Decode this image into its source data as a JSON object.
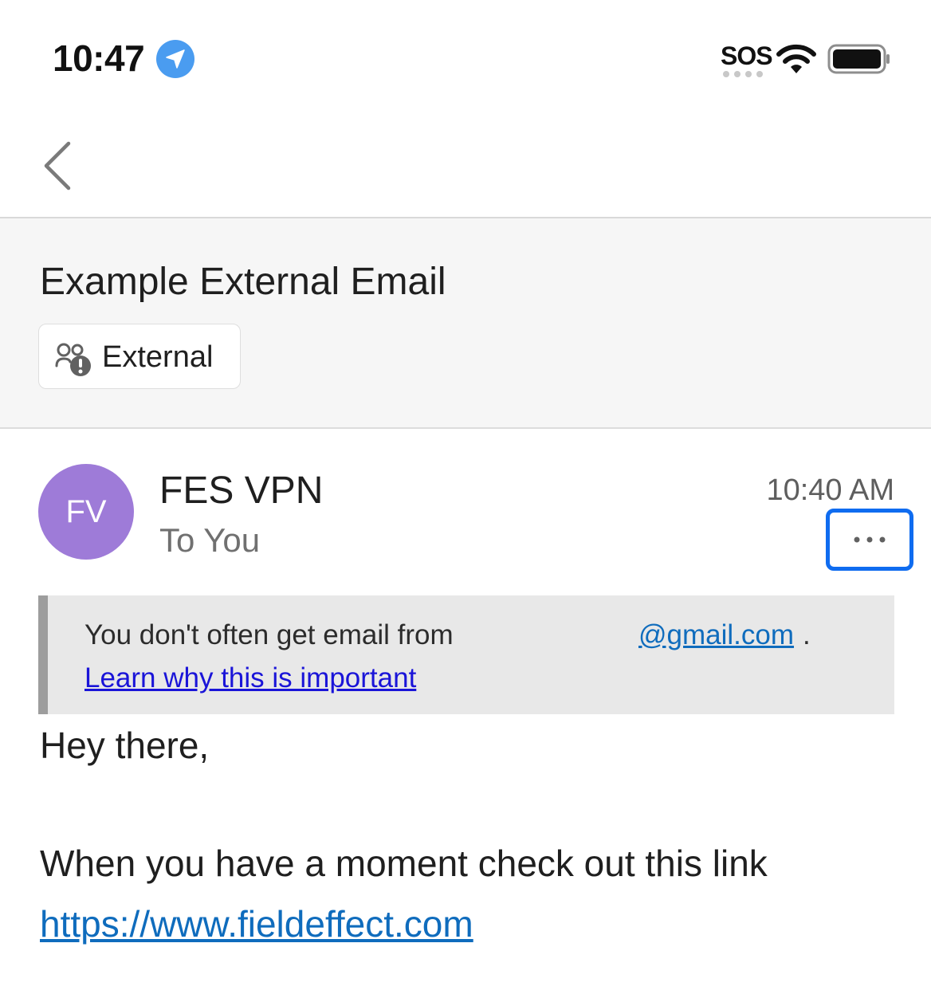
{
  "status_bar": {
    "time": "10:47",
    "carrier": "SOS",
    "icons": [
      "location-arrow-icon",
      "wifi-icon",
      "battery-icon"
    ]
  },
  "nav": {
    "back_icon": "chevron-left-icon"
  },
  "email": {
    "subject": "Example External Email",
    "external_tag": "External",
    "external_icon": "people-warning-icon",
    "sender": {
      "initials": "FV",
      "name": "FES VPN",
      "recipient": "To You",
      "time": "10:40 AM",
      "avatar_color": "#9e7bd8"
    },
    "more_icon": "ellipsis-icon",
    "warning": {
      "text": "You don't often get email from",
      "domain": "@gmail.com",
      "period": ".",
      "link": "Learn why this is important"
    },
    "body": {
      "greeting": "Hey there,",
      "line": "When you have a moment check out this link",
      "link": "https://www.fieldeffect.com"
    }
  },
  "colors": {
    "accent": "#0f6cf0",
    "link": "#0f6cbd",
    "warning_link": "#1a14d8"
  }
}
